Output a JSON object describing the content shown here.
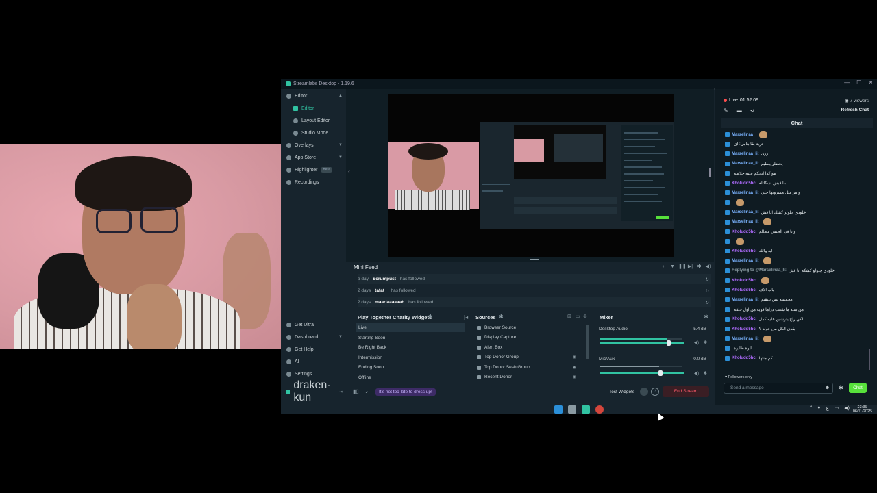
{
  "window": {
    "title": "Streamlabs Desktop - 1.19.6"
  },
  "sidebar": {
    "items": [
      {
        "label": "Editor"
      },
      {
        "label": "Editor"
      },
      {
        "label": "Layout Editor"
      },
      {
        "label": "Studio Mode"
      },
      {
        "label": "Overlays"
      },
      {
        "label": "App Store"
      },
      {
        "label": "Highlighter",
        "badge": "beta"
      },
      {
        "label": "Recordings"
      }
    ],
    "bottom": [
      {
        "label": "Get Ultra"
      },
      {
        "label": "Dashboard"
      },
      {
        "label": "Get Help"
      },
      {
        "label": "AI"
      },
      {
        "label": "Settings"
      }
    ],
    "user": "draken-kun"
  },
  "minifeed": {
    "title": "Mini Feed",
    "rows": [
      {
        "time": "a day",
        "name": "Scrumpust",
        "action": "has followed"
      },
      {
        "time": "2 days",
        "name": "tafat_",
        "action": "has followed"
      },
      {
        "time": "2 days",
        "name": "maariaaaaaah",
        "action": "has followed"
      }
    ]
  },
  "scenes": {
    "title": "Play Together Charity Widgets",
    "items": [
      "Live",
      "Starting Soon",
      "Be Right Back",
      "Intermission",
      "Ending Soon",
      "Offline"
    ]
  },
  "sources": {
    "title": "Sources",
    "items": [
      "Browser Source",
      "Display Capture",
      "Alert Box",
      "Top Donor Group",
      "Top Donor Sesh Group",
      "Recent Donor"
    ]
  },
  "mixer": {
    "title": "Mixer",
    "channels": [
      {
        "name": "Desktop Audio",
        "db": "-5.4 dB",
        "level": 0.82
      },
      {
        "name": "Mic/Aux",
        "db": "0.0 dB",
        "level": 0.72
      }
    ]
  },
  "footer": {
    "promo": "It's not too late to dress up!",
    "test_widgets": "Test Widgets",
    "end_stream": "End Stream"
  },
  "chat": {
    "live_label": "Live",
    "live_time": "01:52:09",
    "viewers": "7 viewers",
    "refresh": "Refresh Chat",
    "header": "Chat",
    "followers_only": "Followers only",
    "input_placeholder": "Send a message",
    "send": "Chat",
    "messages": [
      {
        "user": "Marselinaa_",
        "text": "",
        "color": "#7bb3ff"
      },
      {
        "user": "",
        "text": "خربة بقا هامل: ای",
        "color": "#ff4d6d"
      },
      {
        "user": "Marselinaa_Ii:",
        "text": "رزی",
        "color": "#7bb3ff"
      },
      {
        "user": "Marselinaa_Ii:",
        "text": "يحضلر يبطيم",
        "color": "#7bb3ff"
      },
      {
        "user": "",
        "text": "هو كذا انحكم عليه حلاصة",
        "color": "#ff4d6d"
      },
      {
        "user": "Kholudd5hc:",
        "text": "ما قبش اسكاتله",
        "color": "#b06cff"
      },
      {
        "user": "Marselinaa_Ii:",
        "text": "و مر مثل مسروبها حلي",
        "color": "#7bb3ff"
      },
      {
        "user": "",
        "text": "",
        "color": "#ff4d6d"
      },
      {
        "user": "Marselinaa_Ii:",
        "text": "خلودي جلولو كشك انا قش",
        "color": "#7bb3ff"
      },
      {
        "user": "Marselinaa_Ii:",
        "text": "",
        "color": "#7bb3ff"
      },
      {
        "user": "Kholudd5hc:",
        "text": "وانا في الجنس مطالم",
        "color": "#b06cff"
      },
      {
        "user": "",
        "text": "",
        "color": "#ff4d6d"
      },
      {
        "user": "Kholudd5hc:",
        "text": "ايه والله",
        "color": "#b06cff"
      },
      {
        "user": "Marselinaa_Ii:",
        "text": "",
        "color": "#7bb3ff"
      },
      {
        "user": "Replying to @Marselinaa_Ii:",
        "text": "خلودي جلولو كشكة اتا قش",
        "color": "#8a9aa2"
      },
      {
        "user": "Kholudd5hc:",
        "text": "",
        "color": "#b06cff"
      },
      {
        "user": "Kholudd5hc:",
        "text": "ياب الاف",
        "color": "#b06cff"
      },
      {
        "user": "Marselinaa_Ii:",
        "text": "محمسة بس يلتقيم",
        "color": "#7bb3ff"
      },
      {
        "user": "",
        "text": "من سنة ما شفت دراما قوية من اول حلقة",
        "color": "#ff4d6d"
      },
      {
        "user": "Kholudd5hc:",
        "text": "لكن راح يترشين عليه كمل",
        "color": "#b06cff"
      },
      {
        "user": "Kholudd5hc:",
        "text": "يقدي الكل من حوله ؟",
        "color": "#b06cff"
      },
      {
        "user": "Marselinaa_Ii:",
        "text": "",
        "color": "#7bb3ff"
      },
      {
        "user": "",
        "text": "ايوة طايرة",
        "color": "#ff4d6d"
      },
      {
        "user": "Kholudd5hc:",
        "text": "كم منتها",
        "color": "#b06cff"
      }
    ]
  },
  "taskbar": {
    "time": "23:35",
    "date": "06/11/2025"
  },
  "colors": {
    "accent": "#31c3a2",
    "end_stream": "#ff5a6a",
    "chat_send": "#57e03b"
  }
}
